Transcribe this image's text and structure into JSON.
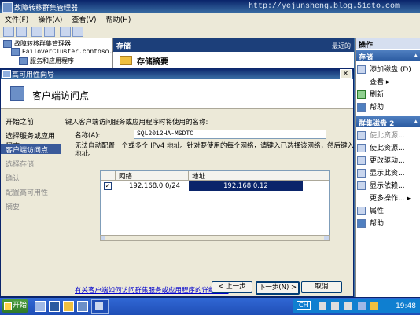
{
  "main_window": {
    "title": "故障转移群集管理器",
    "watermark": "http://yejunsheng.blog.51cto.com"
  },
  "menu": [
    "文件(F)",
    "操作(A)",
    "查看(V)",
    "帮助(H)"
  ],
  "tree": {
    "root": "故障转移群集管理器",
    "cluster": "FailoverCluster.contoso.com",
    "node": "服务和应用程序"
  },
  "center": {
    "header": "存储",
    "header_right": "最近的",
    "subheader": "存储摘要"
  },
  "actions": {
    "header": "操作",
    "section1": {
      "title": "存储",
      "items": [
        {
          "label": "添加磁盘 (D)",
          "icon": "add-disk-icon"
        },
        {
          "label": "查看",
          "icon": "view-icon",
          "has_submenu": true
        },
        {
          "label": "刷新",
          "icon": "refresh-icon"
        },
        {
          "label": "帮助",
          "icon": "help-icon"
        }
      ]
    },
    "section2": {
      "title": "群集磁盘 2",
      "items": [
        {
          "label": "使此资源...",
          "icon": "resource-icon",
          "dim": true
        },
        {
          "label": "使此资源...",
          "icon": "resource-icon"
        },
        {
          "label": "更改驱动...",
          "icon": "drive-icon"
        },
        {
          "label": "显示此资...",
          "icon": "show-icon"
        },
        {
          "label": "显示依赖...",
          "icon": "dependency-icon"
        },
        {
          "label": "更多操作...",
          "icon": "more-icon",
          "has_submenu": true
        },
        {
          "label": "属性",
          "icon": "properties-icon"
        },
        {
          "label": "帮助",
          "icon": "help-icon"
        }
      ]
    }
  },
  "wizard": {
    "title": "高可用性向导",
    "page_title": "客户端访问点",
    "steps": [
      {
        "label": "开始之前",
        "state": "done"
      },
      {
        "label": "选择服务或应用程序",
        "state": "done"
      },
      {
        "label": "客户端访问点",
        "state": "current"
      },
      {
        "label": "选择存储",
        "state": "pending"
      },
      {
        "label": "确认",
        "state": "pending"
      },
      {
        "label": "配置高可用性",
        "state": "pending"
      },
      {
        "label": "摘要",
        "state": "pending"
      }
    ],
    "instruction": "键入客户端访问服务或应用程序时将使用的名称:",
    "name_label": "名称(A):",
    "name_value": "SQL2012HA-MSDTC",
    "network_note_line1": "无法自动配置一个或多个 IPv4 地址。针对要使用的每个网络，请键入已选择该网络，然后键入",
    "network_note_line2": "地址。",
    "table": {
      "headers": [
        "网络",
        "地址"
      ],
      "rows": [
        {
          "checked": true,
          "network": "192.168.0.0/24",
          "address": "192.168.0.12"
        }
      ]
    },
    "more_info_link": "有关客户端如何访问群集服务或应用程序的详细信息",
    "buttons": {
      "prev": "< 上一步",
      "next": "下一步(N) >",
      "cancel": "取消"
    }
  },
  "taskbar": {
    "start_label": "开始",
    "lang": "CH",
    "clock": "19:48"
  }
}
